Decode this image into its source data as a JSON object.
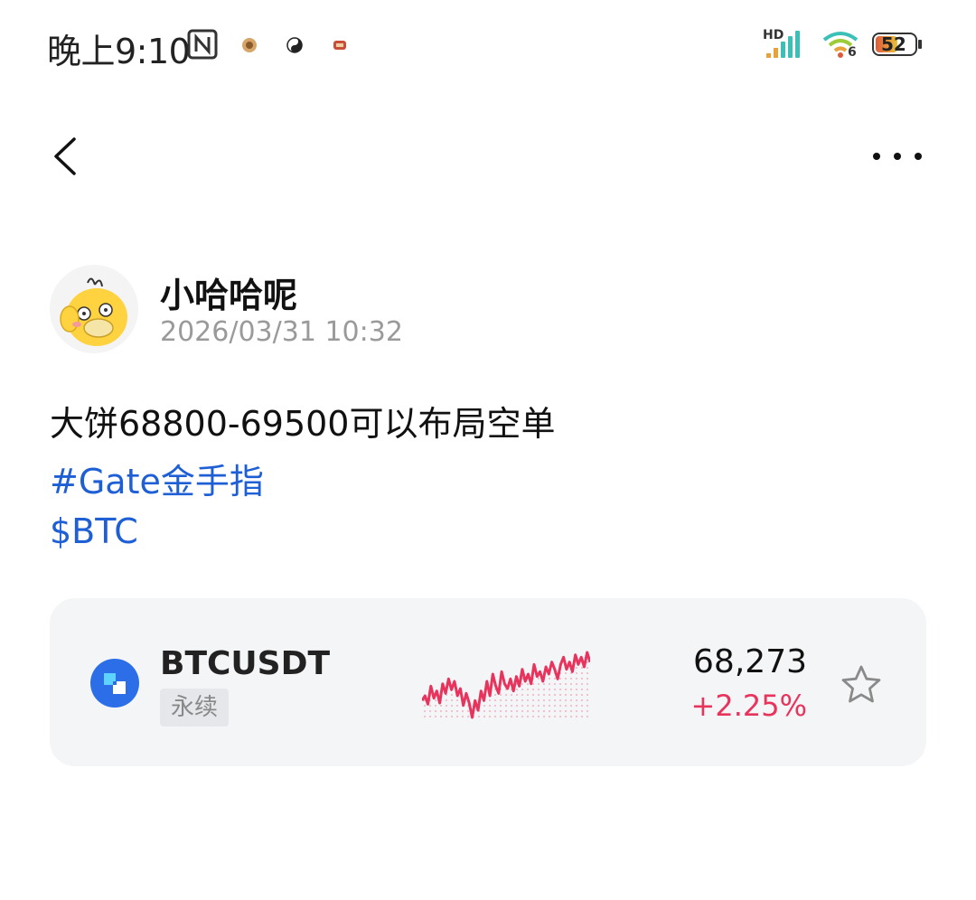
{
  "status_bar": {
    "time": "晚上9:10",
    "network_label": "HD",
    "wifi_label": "6",
    "battery": "52"
  },
  "nav": {
    "back_icon": "chevron-left-icon",
    "more_icon": "more-dots-icon"
  },
  "post": {
    "author": "小哈哈呢",
    "timestamp": "2026/03/31 10:32",
    "text": "大饼68800-69500可以布局空单",
    "hashtag": "#Gate金手指",
    "coin_tag": "$BTC"
  },
  "market_card": {
    "pair": "BTCUSDT",
    "badge": "永续",
    "price": "68,273",
    "change": "+2.25%",
    "accent_color": "#e8335c",
    "link_color": "#1e5fd6",
    "logo_color": "#2b6ee8",
    "star_icon": "star-outline-icon",
    "sparkline": [
      48,
      52,
      45,
      60,
      50,
      56,
      46,
      62,
      54,
      66,
      57,
      64,
      52,
      58,
      44,
      54,
      46,
      34,
      48,
      40,
      56,
      48,
      64,
      52,
      70,
      60,
      54,
      72,
      62,
      58,
      66,
      56,
      68,
      60,
      74,
      64,
      70,
      62,
      78,
      68,
      72,
      64,
      76,
      70,
      80,
      74,
      66,
      78,
      84,
      74,
      80,
      72,
      86,
      78,
      84,
      76,
      88,
      80
    ]
  }
}
